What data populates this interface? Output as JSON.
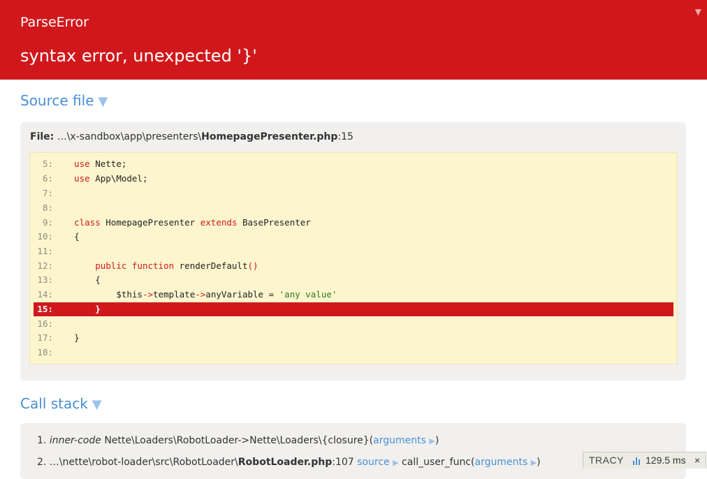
{
  "error": {
    "type": "ParseError",
    "message": "syntax error, unexpected '}'",
    "toggle_icon": "▼"
  },
  "source": {
    "title": "Source file",
    "toggle_icon": "▼",
    "file_label": "File:",
    "file_path": "…\\x-sandbox\\app\\presenters\\",
    "file_name": "HomepagePresenter.php",
    "file_line": ":15",
    "lines": [
      {
        "num": "5:",
        "highlight": false
      },
      {
        "num": "6:",
        "highlight": false
      },
      {
        "num": "7:",
        "highlight": false
      },
      {
        "num": "8:",
        "highlight": false
      },
      {
        "num": "9:",
        "highlight": false
      },
      {
        "num": "10:",
        "highlight": false
      },
      {
        "num": "11:",
        "highlight": false
      },
      {
        "num": "12:",
        "highlight": false
      },
      {
        "num": "13:",
        "highlight": false
      },
      {
        "num": "14:",
        "highlight": false
      },
      {
        "num": "15:",
        "highlight": true
      },
      {
        "num": "16:",
        "highlight": false
      },
      {
        "num": "17:",
        "highlight": false
      },
      {
        "num": "18:",
        "highlight": false
      }
    ],
    "code": {
      "l5_kw": "use",
      "l5_rest": " Nette;",
      "l6_kw": "use",
      "l6_rest": " App\\Model;",
      "l9_kw1": "class",
      "l9_mid": " HomepagePresenter ",
      "l9_kw2": "extends",
      "l9_rest": " BasePresenter",
      "l10": "{",
      "l12_kw1": "public",
      "l12_kw2": "function",
      "l12_rest": " renderDefault",
      "l12_paren": "()",
      "l13": "{",
      "l14_a": "$this",
      "l14_op1": "->",
      "l14_b": "template",
      "l14_op2": "->",
      "l14_c": "anyVariable = ",
      "l14_str": "'any value'",
      "l15": "}",
      "l17": "}"
    }
  },
  "callstack": {
    "title": "Call stack",
    "toggle_icon": "▼",
    "items": [
      {
        "num": "1.",
        "italic": "inner-code",
        "text": " Nette\\Loaders\\RobotLoader->Nette\\Loaders\\{closure}(",
        "link": "arguments",
        "arrow": "▶",
        "close": ")"
      },
      {
        "num": "2.",
        "path": " …\\nette\\robot-loader\\src\\RobotLoader\\",
        "file": "RobotLoader.php",
        "line": ":107",
        "source_link": "source",
        "arrow1": "▶",
        "func": " call_user_func(",
        "link": "arguments",
        "arrow2": "▶",
        "close": ")"
      }
    ]
  },
  "tracy": {
    "logo": "TRACY",
    "time": "129.5 ms",
    "close": "×"
  },
  "colors": {
    "header": "#d0181c",
    "link": "#4a8fd3",
    "code_bg": "#fdf5ce"
  }
}
